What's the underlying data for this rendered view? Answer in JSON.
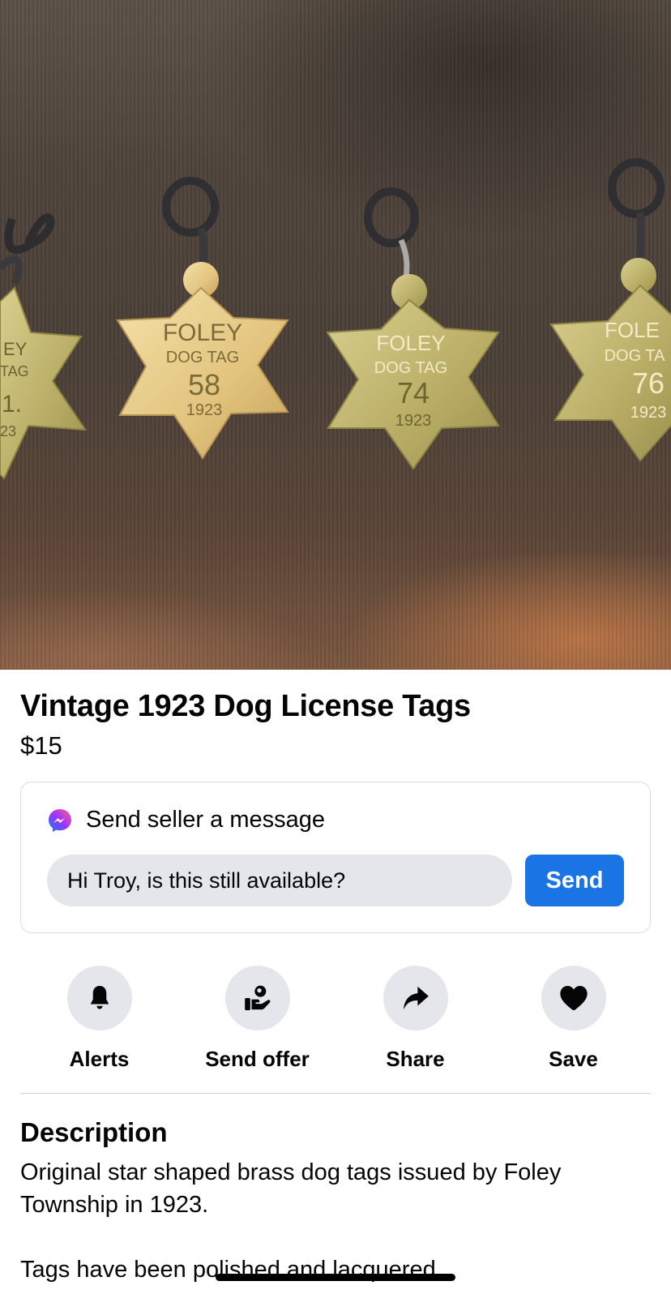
{
  "listing": {
    "title": "Vintage 1923 Dog License Tags",
    "price": "$15"
  },
  "photo": {
    "tags": [
      {
        "lines": [
          "EY",
          "TAG",
          "1.",
          "23"
        ]
      },
      {
        "lines": [
          "FOLEY",
          "DOG TAG",
          "58",
          "1923"
        ]
      },
      {
        "lines": [
          "FOLEY",
          "DOG TAG",
          "74",
          "1923"
        ]
      },
      {
        "lines": [
          "FOLE",
          "DOG TA",
          "76",
          "1923"
        ]
      }
    ]
  },
  "message": {
    "heading": "Send seller a message",
    "input_value": "Hi Troy, is this still available?",
    "send_label": "Send",
    "icon": "messenger-icon"
  },
  "actions": [
    {
      "label": "Alerts",
      "icon": "bell-icon"
    },
    {
      "label": "Send offer",
      "icon": "offer-hand-icon"
    },
    {
      "label": "Share",
      "icon": "share-arrow-icon"
    },
    {
      "label": "Save",
      "icon": "heart-icon"
    }
  ],
  "description": {
    "heading": "Description",
    "text": "Original star shaped brass dog tags issued by Foley Township in 1923.\n\nTags have been polished and lacquered."
  },
  "colors": {
    "accent": "#1b74e4",
    "chip": "#e4e6eb",
    "border": "#dadde1"
  }
}
